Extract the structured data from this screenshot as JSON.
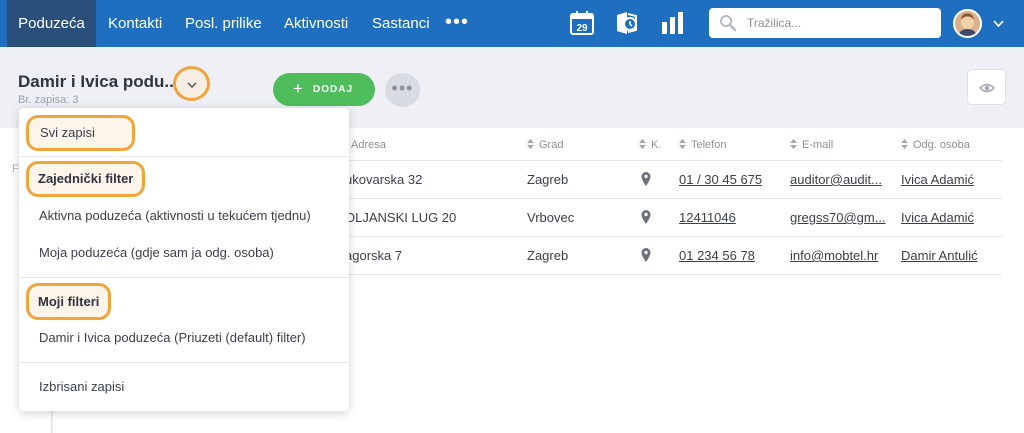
{
  "nav": {
    "tabs": [
      {
        "label": "Poduzeća",
        "active": true
      },
      {
        "label": "Kontakti"
      },
      {
        "label": "Posl. prilike"
      },
      {
        "label": "Aktivnosti"
      },
      {
        "label": "Sastanci"
      }
    ],
    "more": "•••",
    "calendar_day": "29",
    "icons": [
      "calendar-icon",
      "activity-history-icon",
      "reports-icon"
    ],
    "search_placeholder": "Tražilica..."
  },
  "header": {
    "title": "Damir i Ivica podu..",
    "record_count": "Br. zapisa: 3",
    "add_label": "DODAJ",
    "add_icon": "+",
    "more_icon": "•••"
  },
  "left_panel": {
    "letter": "F"
  },
  "table": {
    "columns": [
      "Adresa",
      "Grad",
      "K.",
      "Telefon",
      "E-mail",
      "Odg. osoba"
    ],
    "rows": [
      {
        "address": "ukovarska 32",
        "city": "Zagreb",
        "phone": "01 / 30 45 675",
        "email": "auditor@audit...",
        "owner": "Ivica Adamić"
      },
      {
        "address": "OLJANSKI LUG 20",
        "city": "Vrbovec",
        "phone": "12411046",
        "email": "gregss70@gm...",
        "owner": "Ivica Adamić"
      },
      {
        "address": "agorska 7",
        "city": "Zagreb",
        "phone": "01 234 56 78",
        "email": "info@mobtel.hr",
        "owner": "Damir Antulić"
      }
    ]
  },
  "dropdown": {
    "all_records": "Svi zapisi",
    "shared_header": "Zajednički filter",
    "shared_items": [
      "Aktivna poduzeća (aktivnosti u tekućem tjednu)",
      "Moja poduzeća (gdje sam ja odg. osoba)"
    ],
    "my_header": "Moji filteri",
    "my_items": [
      "Damir i Ivica poduzeća (Priuzeti (default) filter)"
    ],
    "deleted": "Izbrisani zapisi"
  },
  "colors": {
    "nav_bg": "#1f6fc0",
    "nav_active": "#2a4f7b",
    "highlight": "#f0a43a",
    "add_button": "#4fbd5b"
  }
}
